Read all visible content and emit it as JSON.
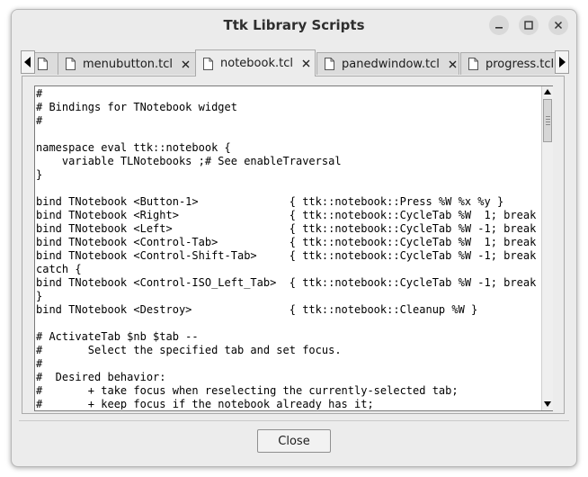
{
  "window": {
    "title": "Ttk Library Scripts"
  },
  "tabs": [
    {
      "label": "",
      "file_icon": "file-icon"
    },
    {
      "label": "menubutton.tcl",
      "file_icon": "file-icon"
    },
    {
      "label": "notebook.tcl",
      "file_icon": "file-icon",
      "active": true
    },
    {
      "label": "panedwindow.tcl",
      "file_icon": "file-icon"
    },
    {
      "label": "progress.tcl",
      "file_icon": "file-icon"
    }
  ],
  "code_lines": [
    "#",
    "# Bindings for TNotebook widget",
    "#",
    "",
    "namespace eval ttk::notebook {",
    "    variable TLNotebooks ;# See enableTraversal",
    "}",
    "",
    "bind TNotebook <Button-1>              { ttk::notebook::Press %W %x %y }",
    "bind TNotebook <Right>                 { ttk::notebook::CycleTab %W  1; break }",
    "bind TNotebook <Left>                  { ttk::notebook::CycleTab %W -1; break }",
    "bind TNotebook <Control-Tab>           { ttk::notebook::CycleTab %W  1; break }",
    "bind TNotebook <Control-Shift-Tab>     { ttk::notebook::CycleTab %W -1; break }",
    "catch {",
    "bind TNotebook <Control-ISO_Left_Tab>  { ttk::notebook::CycleTab %W -1; break }",
    "}",
    "bind TNotebook <Destroy>               { ttk::notebook::Cleanup %W }",
    "",
    "# ActivateTab $nb $tab --",
    "#       Select the specified tab and set focus.",
    "#",
    "#  Desired behavior:",
    "#       + take focus when reselecting the currently-selected tab;",
    "#       + keep focus if the notebook already has it;"
  ],
  "buttons": {
    "close_label": "Close"
  },
  "colors": {
    "active_tab_bg": "#ececec",
    "inactive_tab_bg": "#dcdcdc",
    "text_bg": "#ffffff"
  }
}
